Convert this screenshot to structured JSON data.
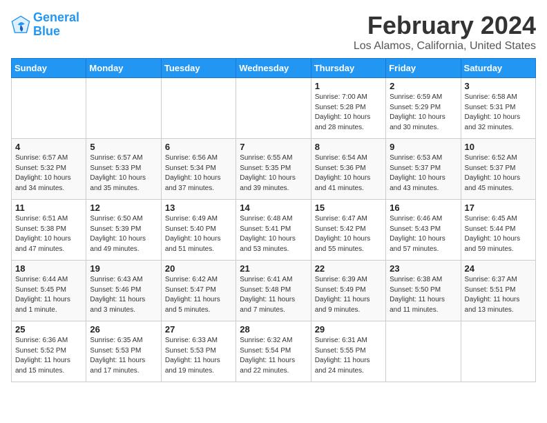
{
  "logo": {
    "line1": "General",
    "line2": "Blue"
  },
  "title": "February 2024",
  "subtitle": "Los Alamos, California, United States",
  "days_header": [
    "Sunday",
    "Monday",
    "Tuesday",
    "Wednesday",
    "Thursday",
    "Friday",
    "Saturday"
  ],
  "weeks": [
    [
      {
        "day": "",
        "info": ""
      },
      {
        "day": "",
        "info": ""
      },
      {
        "day": "",
        "info": ""
      },
      {
        "day": "",
        "info": ""
      },
      {
        "day": "1",
        "info": "Sunrise: 7:00 AM\nSunset: 5:28 PM\nDaylight: 10 hours\nand 28 minutes."
      },
      {
        "day": "2",
        "info": "Sunrise: 6:59 AM\nSunset: 5:29 PM\nDaylight: 10 hours\nand 30 minutes."
      },
      {
        "day": "3",
        "info": "Sunrise: 6:58 AM\nSunset: 5:31 PM\nDaylight: 10 hours\nand 32 minutes."
      }
    ],
    [
      {
        "day": "4",
        "info": "Sunrise: 6:57 AM\nSunset: 5:32 PM\nDaylight: 10 hours\nand 34 minutes."
      },
      {
        "day": "5",
        "info": "Sunrise: 6:57 AM\nSunset: 5:33 PM\nDaylight: 10 hours\nand 35 minutes."
      },
      {
        "day": "6",
        "info": "Sunrise: 6:56 AM\nSunset: 5:34 PM\nDaylight: 10 hours\nand 37 minutes."
      },
      {
        "day": "7",
        "info": "Sunrise: 6:55 AM\nSunset: 5:35 PM\nDaylight: 10 hours\nand 39 minutes."
      },
      {
        "day": "8",
        "info": "Sunrise: 6:54 AM\nSunset: 5:36 PM\nDaylight: 10 hours\nand 41 minutes."
      },
      {
        "day": "9",
        "info": "Sunrise: 6:53 AM\nSunset: 5:37 PM\nDaylight: 10 hours\nand 43 minutes."
      },
      {
        "day": "10",
        "info": "Sunrise: 6:52 AM\nSunset: 5:37 PM\nDaylight: 10 hours\nand 45 minutes."
      }
    ],
    [
      {
        "day": "11",
        "info": "Sunrise: 6:51 AM\nSunset: 5:38 PM\nDaylight: 10 hours\nand 47 minutes."
      },
      {
        "day": "12",
        "info": "Sunrise: 6:50 AM\nSunset: 5:39 PM\nDaylight: 10 hours\nand 49 minutes."
      },
      {
        "day": "13",
        "info": "Sunrise: 6:49 AM\nSunset: 5:40 PM\nDaylight: 10 hours\nand 51 minutes."
      },
      {
        "day": "14",
        "info": "Sunrise: 6:48 AM\nSunset: 5:41 PM\nDaylight: 10 hours\nand 53 minutes."
      },
      {
        "day": "15",
        "info": "Sunrise: 6:47 AM\nSunset: 5:42 PM\nDaylight: 10 hours\nand 55 minutes."
      },
      {
        "day": "16",
        "info": "Sunrise: 6:46 AM\nSunset: 5:43 PM\nDaylight: 10 hours\nand 57 minutes."
      },
      {
        "day": "17",
        "info": "Sunrise: 6:45 AM\nSunset: 5:44 PM\nDaylight: 10 hours\nand 59 minutes."
      }
    ],
    [
      {
        "day": "18",
        "info": "Sunrise: 6:44 AM\nSunset: 5:45 PM\nDaylight: 11 hours\nand 1 minute."
      },
      {
        "day": "19",
        "info": "Sunrise: 6:43 AM\nSunset: 5:46 PM\nDaylight: 11 hours\nand 3 minutes."
      },
      {
        "day": "20",
        "info": "Sunrise: 6:42 AM\nSunset: 5:47 PM\nDaylight: 11 hours\nand 5 minutes."
      },
      {
        "day": "21",
        "info": "Sunrise: 6:41 AM\nSunset: 5:48 PM\nDaylight: 11 hours\nand 7 minutes."
      },
      {
        "day": "22",
        "info": "Sunrise: 6:39 AM\nSunset: 5:49 PM\nDaylight: 11 hours\nand 9 minutes."
      },
      {
        "day": "23",
        "info": "Sunrise: 6:38 AM\nSunset: 5:50 PM\nDaylight: 11 hours\nand 11 minutes."
      },
      {
        "day": "24",
        "info": "Sunrise: 6:37 AM\nSunset: 5:51 PM\nDaylight: 11 hours\nand 13 minutes."
      }
    ],
    [
      {
        "day": "25",
        "info": "Sunrise: 6:36 AM\nSunset: 5:52 PM\nDaylight: 11 hours\nand 15 minutes."
      },
      {
        "day": "26",
        "info": "Sunrise: 6:35 AM\nSunset: 5:53 PM\nDaylight: 11 hours\nand 17 minutes."
      },
      {
        "day": "27",
        "info": "Sunrise: 6:33 AM\nSunset: 5:53 PM\nDaylight: 11 hours\nand 19 minutes."
      },
      {
        "day": "28",
        "info": "Sunrise: 6:32 AM\nSunset: 5:54 PM\nDaylight: 11 hours\nand 22 minutes."
      },
      {
        "day": "29",
        "info": "Sunrise: 6:31 AM\nSunset: 5:55 PM\nDaylight: 11 hours\nand 24 minutes."
      },
      {
        "day": "",
        "info": ""
      },
      {
        "day": "",
        "info": ""
      }
    ]
  ]
}
